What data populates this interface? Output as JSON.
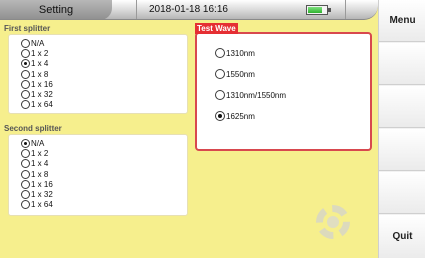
{
  "header": {
    "title": "Setting",
    "datetime": "2018-01-18 16:16",
    "battery_level": 0.8
  },
  "first_splitter": {
    "label": "First splitter",
    "selected": "1 x 4",
    "options": [
      "N/A",
      "1 x 2",
      "1 x 4",
      "1 x 8",
      "1 x 16",
      "1 x 32",
      "1 x 64"
    ]
  },
  "second_splitter": {
    "label": "Second splitter",
    "selected": "N/A",
    "options": [
      "N/A",
      "1 x 2",
      "1 x 4",
      "1 x 8",
      "1 x 16",
      "1 x 32",
      "1 x 64"
    ]
  },
  "test_wave": {
    "label": "Test Wave",
    "selected": "1625nm",
    "options": [
      "1310nm",
      "1550nm",
      "1310nm/1550nm",
      "1625nm"
    ]
  },
  "side_menu": {
    "menu_label": "Menu",
    "quit_label": "Quit"
  },
  "colors": {
    "background": "#f6ef8d",
    "accent": "#e52f33"
  },
  "icons": {
    "battery": "battery-icon",
    "watermark_gear": "gear-icon"
  }
}
